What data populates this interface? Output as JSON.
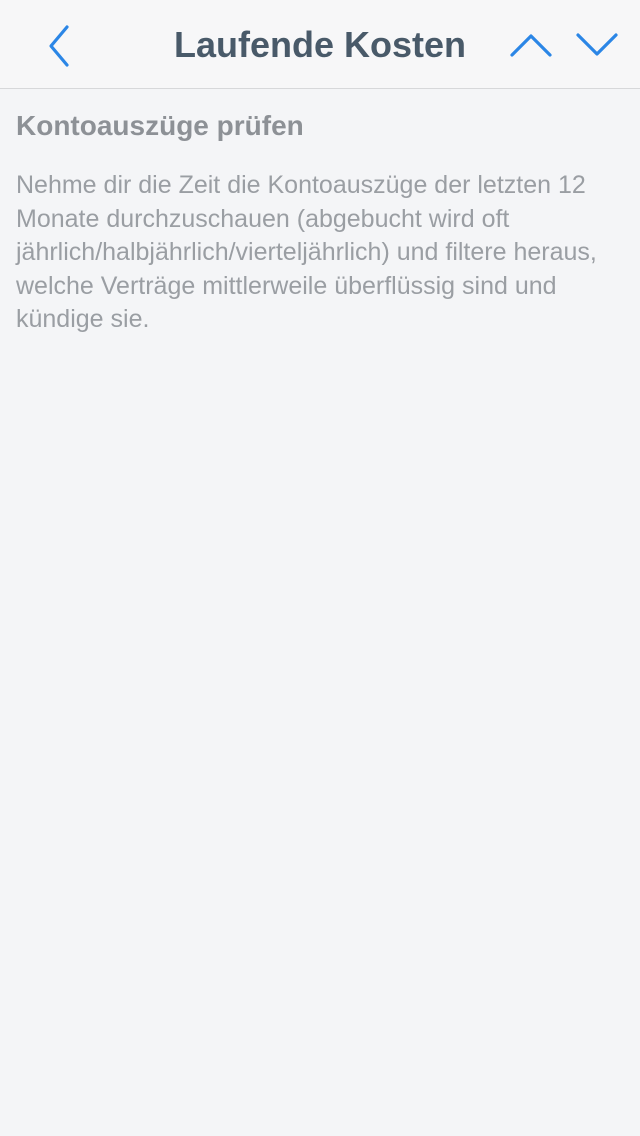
{
  "navbar": {
    "title": "Laufende Kosten",
    "back_icon": "chevron-left-icon",
    "previous_icon": "chevron-up-icon",
    "next_icon": "chevron-down-icon",
    "accent_color": "#2b86e6"
  },
  "article": {
    "title": "Kontoauszüge prüfen",
    "body": "Nehme dir die Zeit die Kontoauszüge der letzten 12 Monate durchzuschauen (abgebucht wird oft jährlich/halbjährlich/vierteljährlich) und filtere heraus, welche Verträge mittlerweile überflüssig sind und kündige sie."
  }
}
